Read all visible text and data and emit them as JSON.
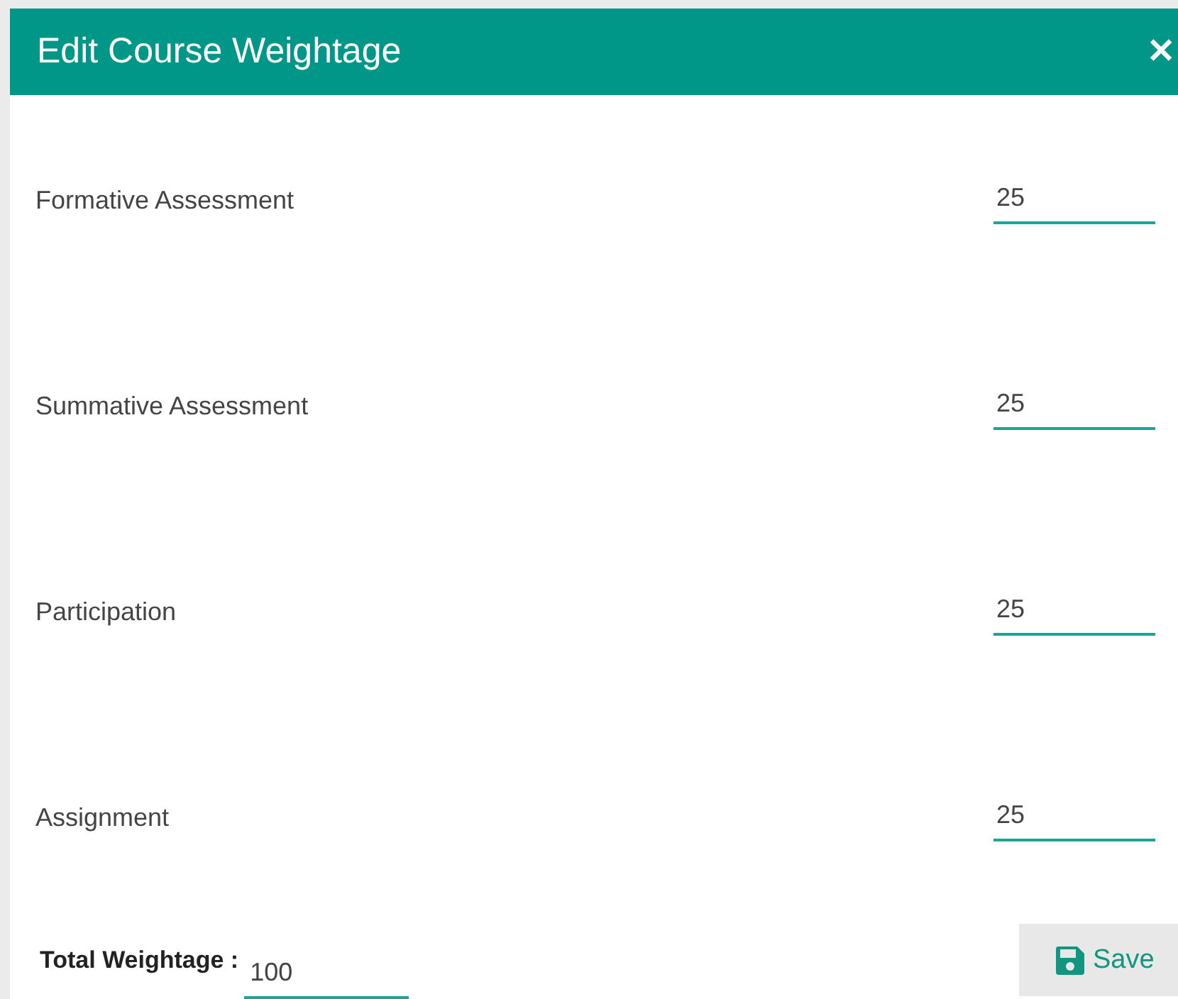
{
  "dialog": {
    "title": "Edit Course Weightage",
    "close": "✕"
  },
  "fields": [
    {
      "label": "Formative Assessment",
      "value": "25"
    },
    {
      "label": "Summative Assessment",
      "value": "25"
    },
    {
      "label": "Participation",
      "value": "25"
    },
    {
      "label": "Assignment",
      "value": "25"
    }
  ],
  "footer": {
    "total_label": "Total Weightage :",
    "total_value": "100",
    "save": "Save"
  }
}
